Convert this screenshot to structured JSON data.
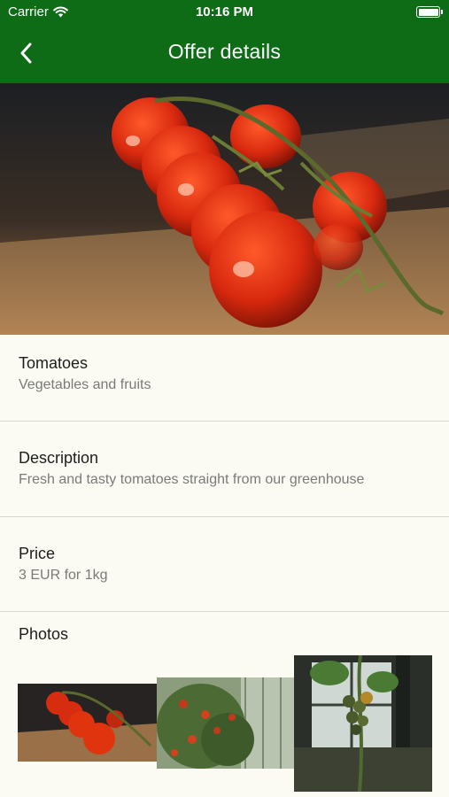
{
  "status_bar": {
    "carrier": "Carrier",
    "time": "10:16 PM"
  },
  "nav": {
    "title": "Offer details",
    "back_icon": "chevron-left-icon"
  },
  "product": {
    "name": "Tomatoes",
    "category": "Vegetables and fruits"
  },
  "description": {
    "label": "Description",
    "text": "Fresh and tasty tomatoes straight from our greenhouse"
  },
  "price": {
    "label": "Price",
    "text": "3 EUR for 1kg"
  },
  "photos": {
    "label": "Photos"
  },
  "colors": {
    "brand_green": "#0e6b16",
    "background": "#fbfbf3"
  }
}
